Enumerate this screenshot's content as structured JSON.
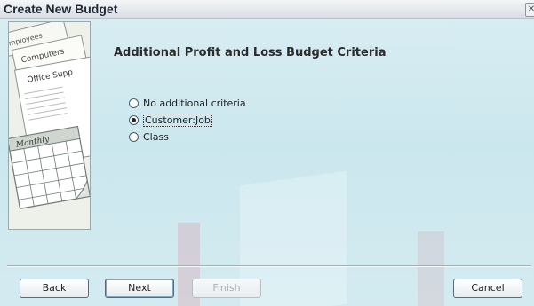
{
  "window": {
    "title": "Create New Budget"
  },
  "heading": "Additional Profit and Loss Budget Criteria",
  "art": {
    "labels": [
      "mployees",
      "Computers",
      "Office Supp",
      "Monthly"
    ]
  },
  "criteria": {
    "options": [
      {
        "label": "No additional criteria",
        "checked": false
      },
      {
        "label": "Customer:Job",
        "checked": true
      },
      {
        "label": "Class",
        "checked": false
      }
    ]
  },
  "buttons": {
    "back": "Back",
    "next": "Next",
    "finish": "Finish",
    "cancel": "Cancel"
  },
  "colors": {
    "background": "#cfe9ef",
    "title_text": "#1f2a36"
  }
}
